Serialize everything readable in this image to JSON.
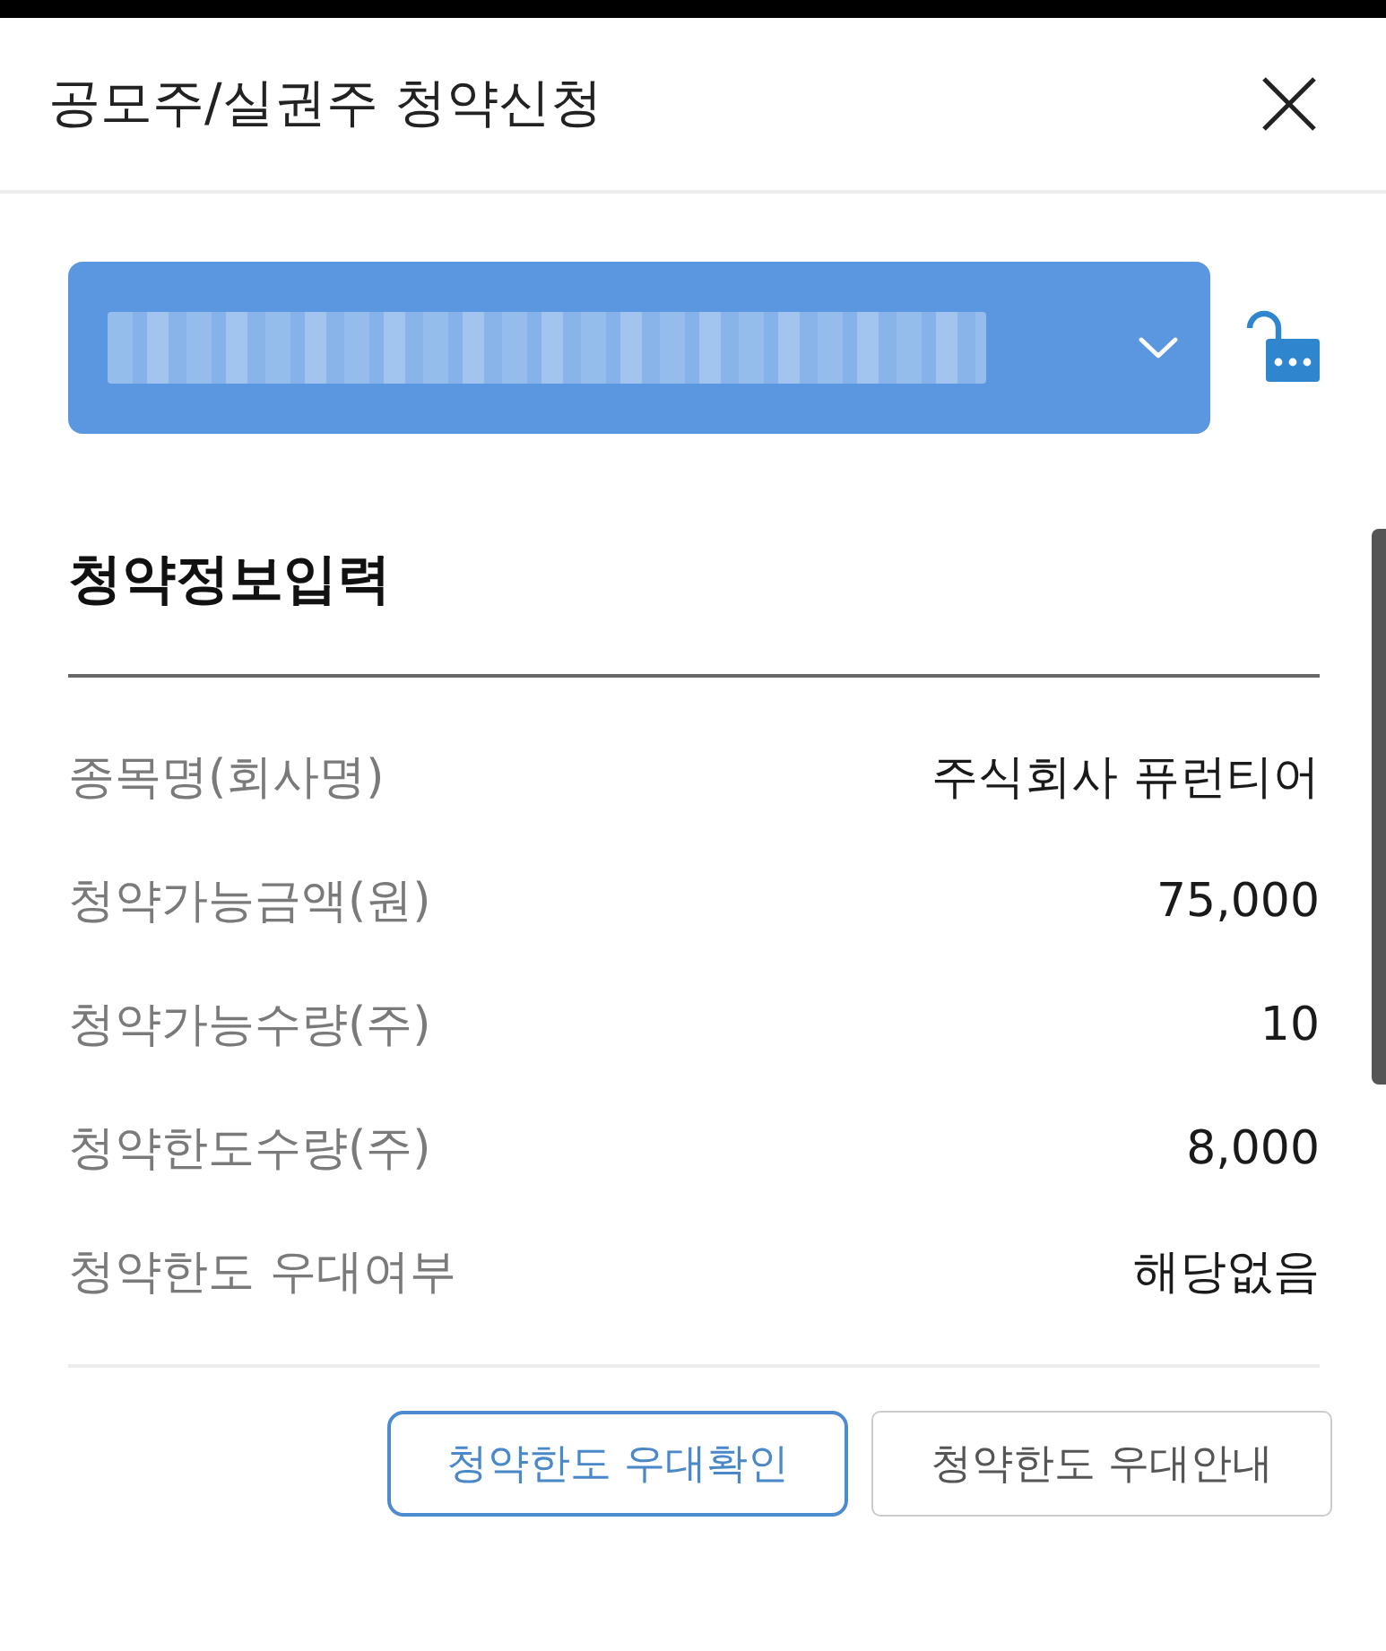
{
  "header": {
    "title": "공모주/실권주 청약신청"
  },
  "section": {
    "title": "청약정보입력",
    "rows": [
      {
        "label": "종목명(회사명)",
        "value": "주식회사 퓨런티어"
      },
      {
        "label": "청약가능금액(원)",
        "value": "75,000"
      },
      {
        "label": "청약가능수량(주)",
        "value": "10"
      },
      {
        "label": "청약한도수량(주)",
        "value": "8,000"
      },
      {
        "label": "청약한도 우대여부",
        "value": "해당없음"
      }
    ]
  },
  "buttons": [
    {
      "label": "청약한도 우대확인",
      "kind": "primary"
    },
    {
      "label": "청약한도 우대안내",
      "kind": "secondary"
    }
  ]
}
